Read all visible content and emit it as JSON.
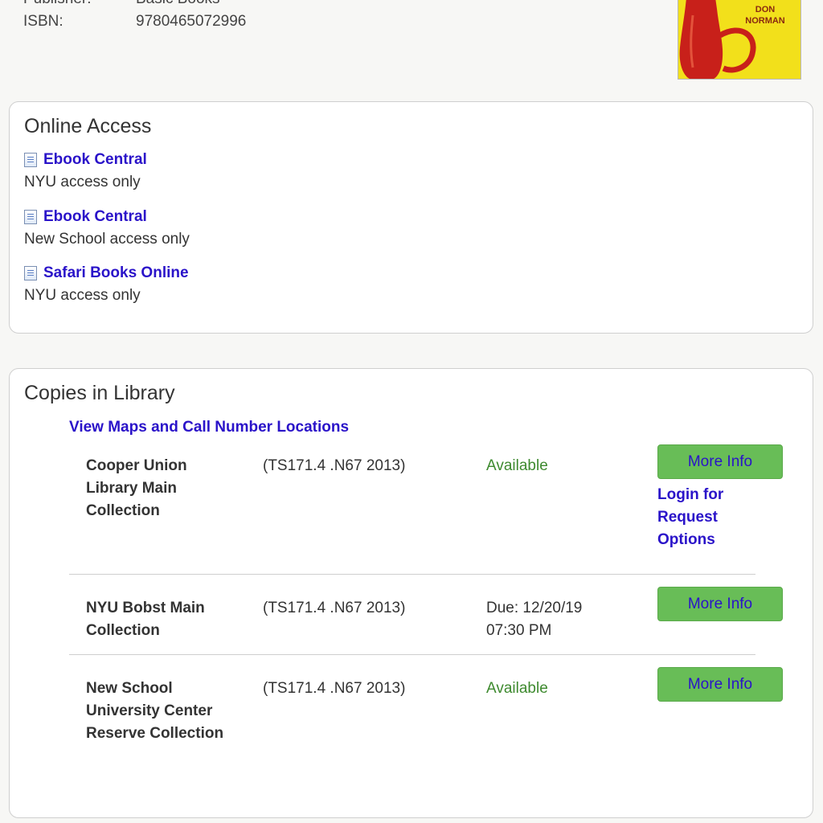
{
  "record": {
    "publisher_label": "Publisher:",
    "publisher_value": "Basic Books",
    "isbn_label": "ISBN:",
    "isbn_value": "9780465072996",
    "cover_author": "DON NORMAN"
  },
  "online_access": {
    "title": "Online Access",
    "items": [
      {
        "link": "Ebook Central",
        "note": "NYU access only"
      },
      {
        "link": "Ebook Central",
        "note": "New School access only"
      },
      {
        "link": "Safari Books Online",
        "note": "NYU access only"
      }
    ]
  },
  "copies": {
    "title": "Copies in Library",
    "maps_link": "View Maps and Call Number Locations",
    "holdings": [
      {
        "location": "Cooper Union Library Main Collection",
        "call_number": "(TS171.4 .N67 2013)",
        "status": "Available",
        "button": "More Info",
        "login": "Login for Request Options"
      },
      {
        "location": "NYU Bobst Main Collection",
        "call_number": "(TS171.4 .N67 2013)",
        "status": "Due: 12/20/19 07:30 PM",
        "button": "More Info"
      },
      {
        "location": "New School University Center Reserve Collection",
        "call_number": "(TS171.4 .N67 2013)",
        "status": "Available",
        "button": "More Info"
      }
    ]
  },
  "colors": {
    "link": "#2a13c9",
    "available": "#3e8a2f",
    "button_bg": "#68bd57",
    "cover_bg": "#f2e01b",
    "teapot": "#c8201a"
  },
  "icons": {
    "access_link_icon": "document-icon"
  }
}
